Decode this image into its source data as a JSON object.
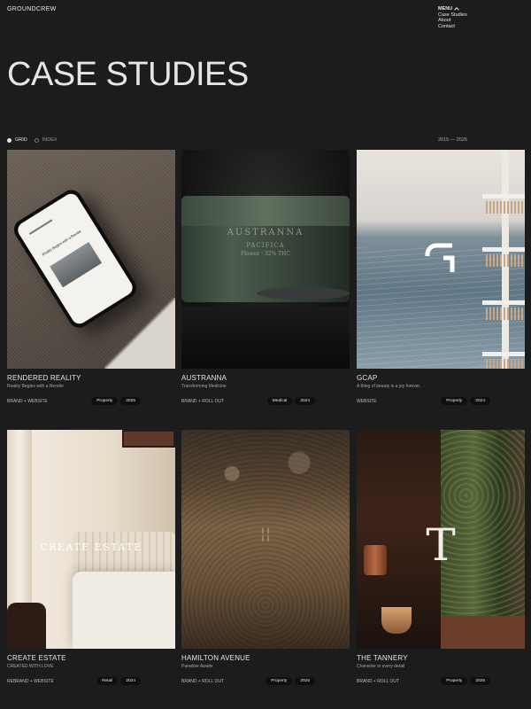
{
  "brand": {
    "logo": "GROUNDCREW"
  },
  "menu": {
    "label": "MENU",
    "items": [
      "Case Studies",
      "About",
      "Contact"
    ]
  },
  "page": {
    "title": "CASE STUDIES"
  },
  "view_toggle": {
    "grid_label": "GRID",
    "index_label": "INDEX",
    "active": "GRID"
  },
  "year_range": "2015 — 2026",
  "cards": [
    {
      "title": "RENDERED REALITY",
      "subtitle": "Reality Begins with a Render",
      "services": "BRAND + WEBSITE",
      "tags": [
        "Property",
        "2025"
      ]
    },
    {
      "title": "AUSTRANNA",
      "subtitle": "Transforming Medicine",
      "services": "BRAND + ROLL OUT",
      "tags": [
        "Medical",
        "2024"
      ],
      "image_text": {
        "brand": "AUSTRANNA",
        "variant": "PACIFICA",
        "detail": "Flower · 32% THC"
      }
    },
    {
      "title": "GCAP",
      "subtitle": "A thing of beauty is a joy forever.",
      "services": "WEBSITE",
      "tags": [
        "Property",
        "2024"
      ]
    },
    {
      "title": "CREATE ESTATE",
      "subtitle": "CREATED WITH LOVE",
      "services": "REBRAND + WEBSITE",
      "tags": [
        "Retail",
        "2024"
      ],
      "image_text": {
        "brand": "CREATE ESTATE"
      }
    },
    {
      "title": "HAMILTON AVENUE",
      "subtitle": "Paradise Awaits",
      "services": "BRAND + ROLL OUT",
      "tags": [
        "Property",
        "2025"
      ]
    },
    {
      "title": "THE TANNERY",
      "subtitle": "Character in every detail",
      "services": "BRAND + ROLL OUT",
      "tags": [
        "Property",
        "2025"
      ]
    }
  ],
  "phone_screen": {
    "headline": "Reality Begins with a Render"
  },
  "colors": {
    "background": "#1c1c1c",
    "text": "#e8e6e2",
    "tag_bg": "#0f0f0f"
  }
}
